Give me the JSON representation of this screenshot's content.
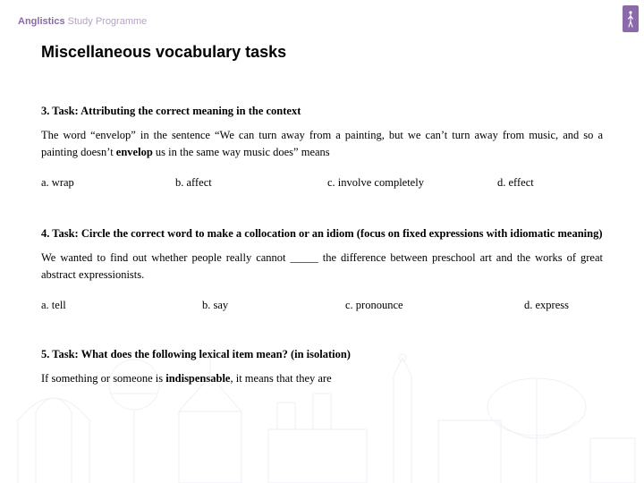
{
  "header": {
    "brand_bold": "Anglistics",
    "brand_light": " Study Programme"
  },
  "page_title": "Miscellaneous vocabulary tasks",
  "task3": {
    "heading": "3. Task: Attributing the correct meaning in the context",
    "body": "The word “envelop” in the sentence “We can turn away from a painting, but we can’t turn away from music, and so a painting doesn’t envelop us in the same way music does” means",
    "opts": {
      "a": "a. wrap",
      "b": "b. affect",
      "c": "c. involve completely",
      "d": "d. effect"
    }
  },
  "task4": {
    "heading": "4. Task: Circle the correct word to make a collocation or an idiom (focus on fixed expressions with idiomatic meaning)",
    "body": "We wanted to find out whether people really cannot _____ the difference between preschool art and the works of great abstract expressionists.",
    "opts": {
      "a": "a. tell",
      "b": "b. say",
      "c": "c. pronounce",
      "d": "d. express"
    }
  },
  "task5": {
    "heading": "5. Task: What does the following lexical item mean? (in isolation)",
    "body": "If something or someone is indispensable, it means that they are"
  }
}
